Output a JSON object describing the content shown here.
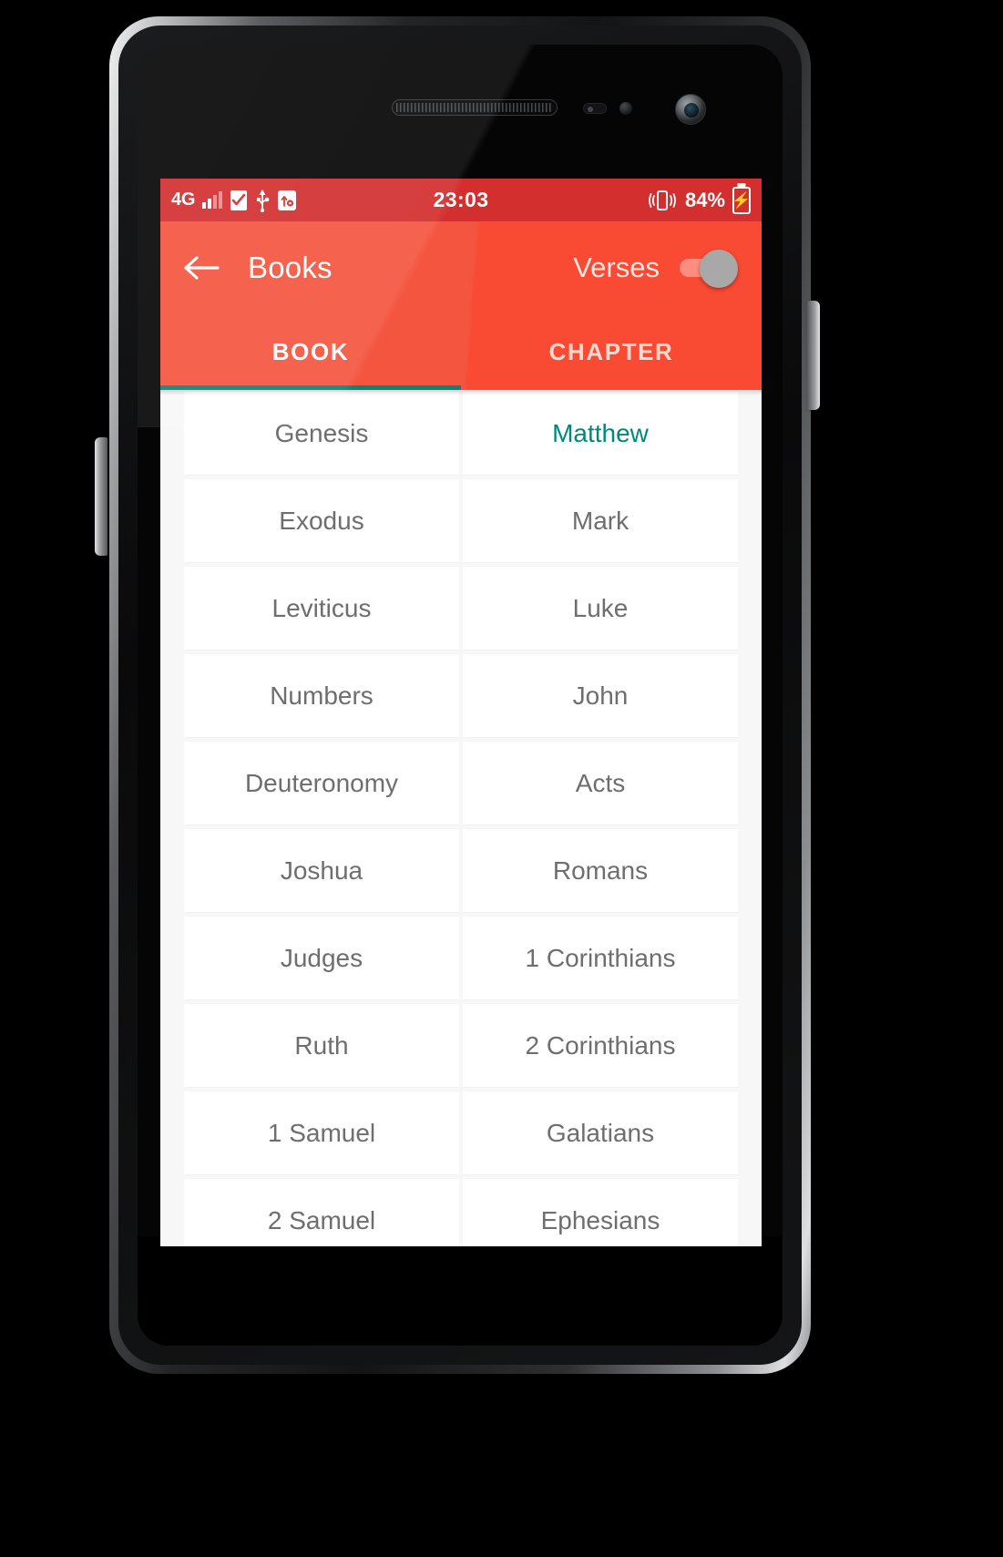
{
  "status_bar": {
    "network_type": "4G",
    "clock": "23:03",
    "battery_percent": "84%",
    "icons": [
      "signal-bars-icon",
      "sim-card-icon",
      "usb-icon",
      "usb-debug-icon",
      "vibrate-icon",
      "battery-charging-icon"
    ]
  },
  "app_bar": {
    "back_label": "back-arrow",
    "title": "Books",
    "verses_label": "Verses",
    "verses_toggle_state": "off"
  },
  "tabs": [
    {
      "label": "BOOK",
      "active": true
    },
    {
      "label": "CHAPTER",
      "active": false
    }
  ],
  "colors": {
    "status_bar": "#d32f2f",
    "app_bar": "#f4553f",
    "accent_teal": "#00897b",
    "cell_text": "#6e6e6e",
    "cell_bg": "#ffffff",
    "grid_bg": "#f7f7f7"
  },
  "books_grid": {
    "rows": [
      {
        "left": {
          "label": "Genesis",
          "selected": false
        },
        "right": {
          "label": "Matthew",
          "selected": true
        }
      },
      {
        "left": {
          "label": "Exodus",
          "selected": false
        },
        "right": {
          "label": "Mark",
          "selected": false
        }
      },
      {
        "left": {
          "label": "Leviticus",
          "selected": false
        },
        "right": {
          "label": "Luke",
          "selected": false
        }
      },
      {
        "left": {
          "label": "Numbers",
          "selected": false
        },
        "right": {
          "label": "John",
          "selected": false
        }
      },
      {
        "left": {
          "label": "Deuteronomy",
          "selected": false
        },
        "right": {
          "label": "Acts",
          "selected": false
        }
      },
      {
        "left": {
          "label": "Joshua",
          "selected": false
        },
        "right": {
          "label": "Romans",
          "selected": false
        }
      },
      {
        "left": {
          "label": "Judges",
          "selected": false
        },
        "right": {
          "label": "1 Corinthians",
          "selected": false
        }
      },
      {
        "left": {
          "label": "Ruth",
          "selected": false
        },
        "right": {
          "label": "2 Corinthians",
          "selected": false
        }
      },
      {
        "left": {
          "label": "1 Samuel",
          "selected": false
        },
        "right": {
          "label": "Galatians",
          "selected": false
        }
      },
      {
        "left": {
          "label": "2 Samuel",
          "selected": false
        },
        "right": {
          "label": "Ephesians",
          "selected": false
        }
      }
    ]
  }
}
